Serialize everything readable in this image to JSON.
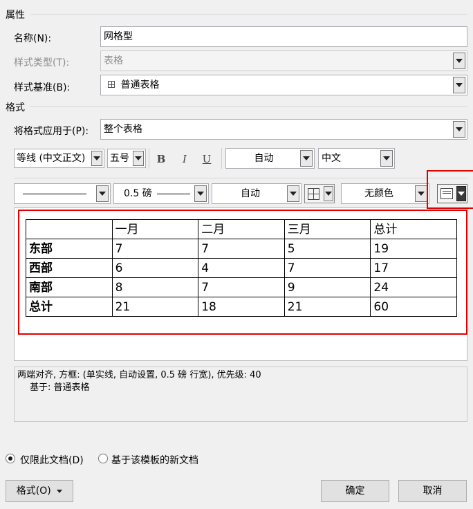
{
  "properties": {
    "section_title": "属性",
    "name_label": "名称(N):",
    "name_value": "网格型",
    "style_type_label": "样式类型(T):",
    "style_type_value": "表格",
    "style_based_label": "样式基准(B):",
    "style_based_value": "普通表格",
    "style_based_icon": "table-grid-icon"
  },
  "format": {
    "section_title": "格式",
    "apply_label": "将格式应用于(P):",
    "apply_value": "整个表格",
    "font_name": "等线 (中文正文)",
    "font_size": "五号",
    "bold_label": "B",
    "italic_label": "I",
    "underline_label": "U",
    "font_color": "自动",
    "language": "中文",
    "border_line_style": "solid-line",
    "border_width": "0.5 磅",
    "border_color": "自动",
    "border_icon": "borders-grid-icon",
    "shading": "无颜色",
    "cell_alignment_icon": "cell-alignment-icon"
  },
  "preview": {
    "header": [
      "",
      "一月",
      "二月",
      "三月",
      "总计"
    ],
    "rows": [
      [
        "东部",
        "7",
        "7",
        "5",
        "19"
      ],
      [
        "西部",
        "6",
        "4",
        "7",
        "17"
      ],
      [
        "南部",
        "8",
        "7",
        "9",
        "24"
      ],
      [
        "总计",
        "21",
        "18",
        "21",
        "60"
      ]
    ]
  },
  "description": {
    "line1": "两端对齐, 方框: (单实线, 自动设置,  0.5 磅 行宽), 优先级: 40",
    "line2": "基于: 普通表格"
  },
  "options": {
    "only_this_doc": "仅限此文档(D)",
    "new_docs_template": "基于该模板的新文档",
    "selected": "only_this_doc"
  },
  "buttons": {
    "format": "格式(O)",
    "ok": "确定",
    "cancel": "取消"
  },
  "colors": {
    "highlight": "#e00000"
  }
}
